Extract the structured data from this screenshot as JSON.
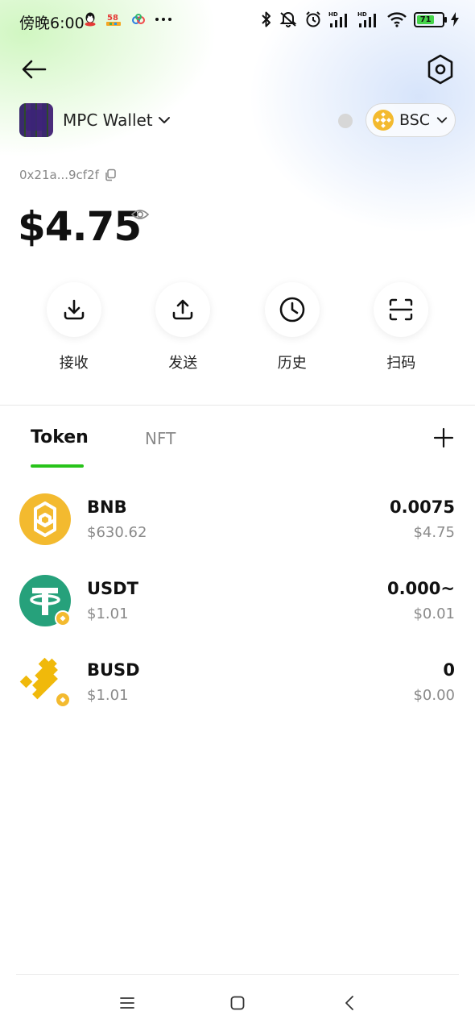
{
  "status_bar": {
    "time": "傍晚6:00",
    "battery_level": "71",
    "left_icons": [
      "qq-icon",
      "58-app-icon",
      "cloud-app-icon",
      "more-dots-icon"
    ],
    "right_icons": [
      "bluetooth-icon",
      "mute-icon",
      "alarm-icon",
      "signal-hd-icon",
      "signal-hd-icon",
      "wifi-icon",
      "battery-icon",
      "charging-icon"
    ]
  },
  "header": {
    "wallet_name": "MPC Wallet",
    "network": "BSC",
    "address": "0x21a...9cf2f",
    "balance": "$4.75"
  },
  "actions": [
    {
      "label": "接收",
      "icon": "receive-icon"
    },
    {
      "label": "发送",
      "icon": "send-icon"
    },
    {
      "label": "历史",
      "icon": "history-icon"
    },
    {
      "label": "扫码",
      "icon": "scan-icon"
    }
  ],
  "tabs": {
    "active": "Token",
    "items": [
      "Token",
      "NFT"
    ]
  },
  "tokens": [
    {
      "symbol": "BNB",
      "price": "$630.62",
      "amount": "0.0075",
      "value": "$4.75",
      "icon": "bnb-icon",
      "color": "#F3BA2F"
    },
    {
      "symbol": "USDT",
      "price": "$1.01",
      "amount": "0.000~",
      "value": "$0.01",
      "icon": "usdt-icon",
      "color": "#26A17B"
    },
    {
      "symbol": "BUSD",
      "price": "$1.01",
      "amount": "0",
      "value": "$0.00",
      "icon": "busd-icon",
      "color": "#F0B90B"
    }
  ],
  "colors": {
    "accent": "#28C31A",
    "muted_text": "#8A8A8A"
  }
}
